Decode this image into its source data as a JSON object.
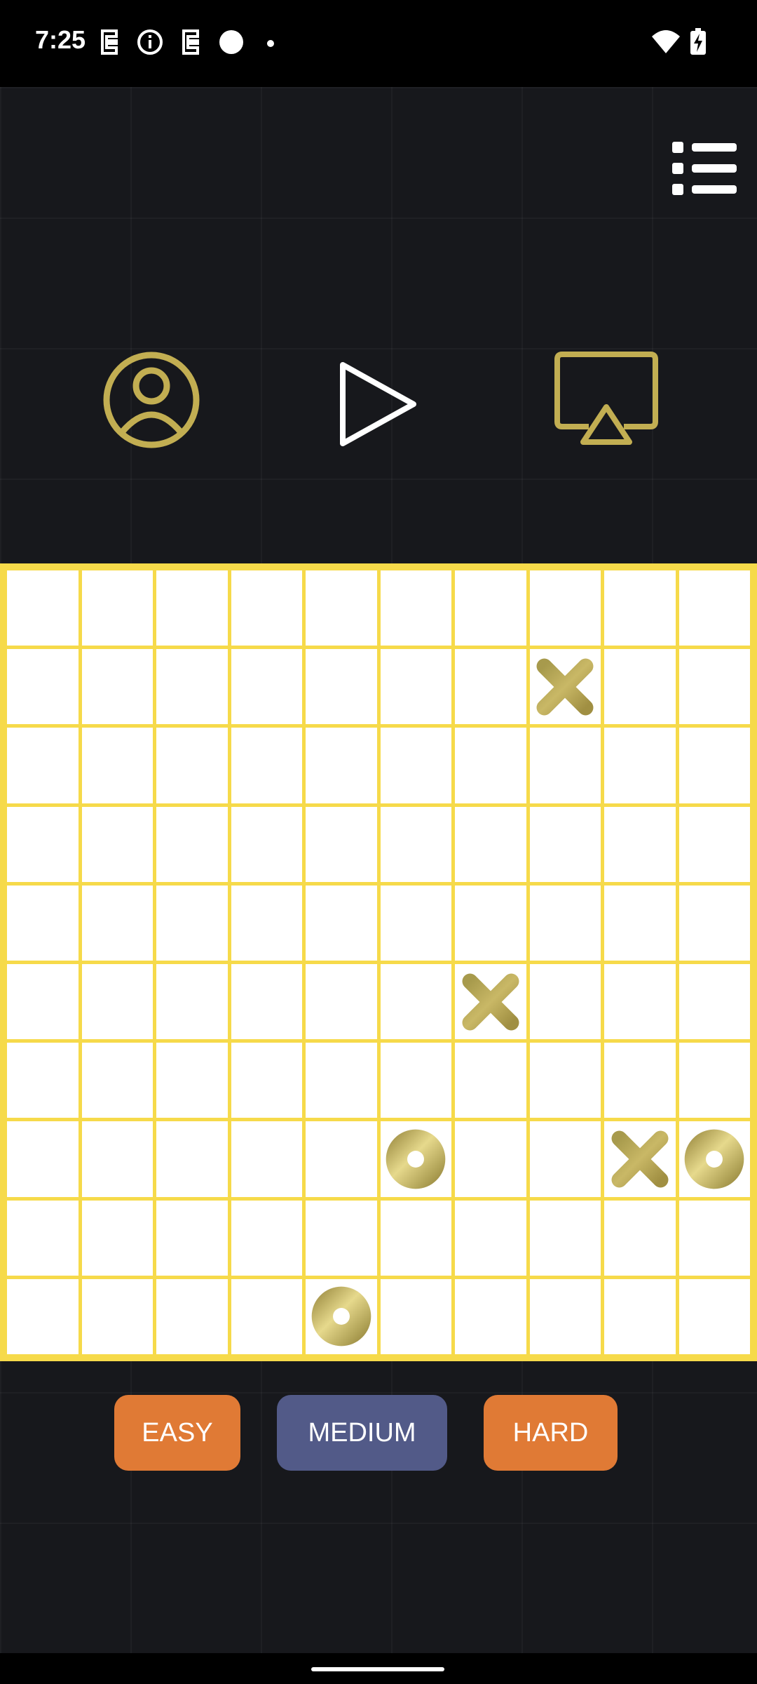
{
  "status_bar": {
    "time": "7:25",
    "icons": [
      "nfc-icon",
      "info-icon",
      "nfc-icon",
      "circle-icon",
      "dot-icon",
      "wifi-icon",
      "battery-charging-icon"
    ]
  },
  "header": {
    "menu_icon": "list-menu-icon",
    "profile_icon": "user-profile-icon",
    "play_icon": "play-icon",
    "cast_icon": "screen-cast-icon"
  },
  "board": {
    "rows": 10,
    "cols": 10,
    "cells": [
      [
        "",
        "",
        "",
        "",
        "",
        "",
        "",
        "",
        "",
        ""
      ],
      [
        "",
        "",
        "",
        "",
        "",
        "",
        "",
        "X",
        "",
        ""
      ],
      [
        "",
        "",
        "",
        "",
        "",
        "",
        "",
        "",
        "",
        ""
      ],
      [
        "",
        "",
        "",
        "",
        "",
        "",
        "",
        "",
        "",
        ""
      ],
      [
        "",
        "",
        "",
        "",
        "",
        "",
        "",
        "",
        "",
        ""
      ],
      [
        "",
        "",
        "",
        "",
        "",
        "",
        "X",
        "",
        "",
        ""
      ],
      [
        "",
        "",
        "",
        "",
        "",
        "",
        "",
        "",
        "",
        ""
      ],
      [
        "",
        "",
        "",
        "",
        "",
        "O",
        "",
        "",
        "X",
        "O"
      ],
      [
        "",
        "",
        "",
        "",
        "",
        "",
        "",
        "",
        "",
        ""
      ],
      [
        "",
        "",
        "",
        "",
        "O",
        "",
        "",
        "",
        "",
        ""
      ]
    ]
  },
  "difficulty": {
    "easy": "EASY",
    "medium": "MEDIUM",
    "hard": "HARD",
    "selected": "MEDIUM"
  },
  "colors": {
    "board_lines": "#f6da4a",
    "icon_gold": "#c2ae52",
    "easy_button": "#e07a35",
    "medium_button": "#525a88",
    "hard_button": "#e07a35"
  }
}
